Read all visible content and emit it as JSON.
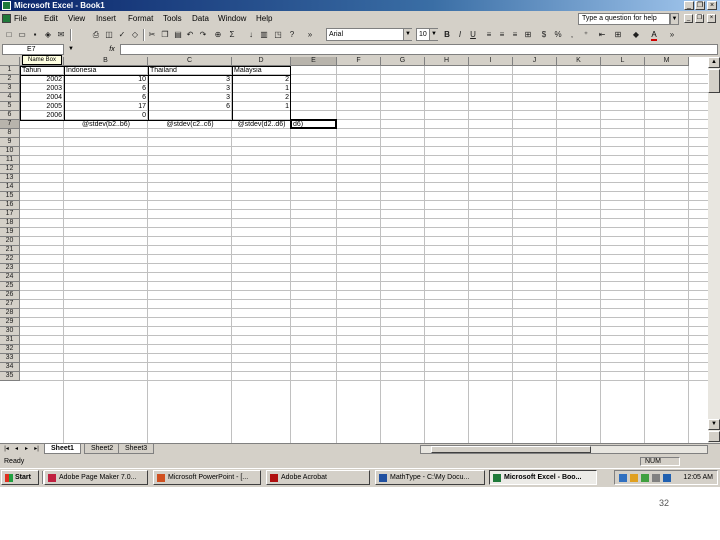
{
  "window": {
    "title": "Microsoft Excel - Book1"
  },
  "menu": [
    "File",
    "Edit",
    "View",
    "Insert",
    "Format",
    "Tools",
    "Data",
    "Window",
    "Help"
  ],
  "help_box": {
    "placeholder": "Type a question for help"
  },
  "toolbar": {
    "font_name": "Arial",
    "font_size": "10"
  },
  "name_box": {
    "value": "E7",
    "tooltip": "Name Box"
  },
  "columns": [
    "A",
    "B",
    "C",
    "D",
    "E",
    "F",
    "G",
    "H",
    "I",
    "J",
    "K",
    "L",
    "M"
  ],
  "active_column": "E",
  "active_row": "7",
  "rows": [
    "1",
    "2",
    "3",
    "4",
    "5",
    "6",
    "7",
    "8",
    "9",
    "10",
    "11",
    "12",
    "13",
    "14",
    "15",
    "16",
    "17",
    "18",
    "19",
    "20",
    "21",
    "22",
    "23",
    "24",
    "25",
    "26",
    "27",
    "28",
    "29",
    "30",
    "31",
    "32",
    "33",
    "34",
    "35"
  ],
  "table": {
    "headers": [
      "Tahun",
      "Indonesia",
      "Thailand",
      "Malaysia"
    ],
    "data": [
      [
        "2002",
        "10",
        "3",
        "2"
      ],
      [
        "2003",
        "6",
        "3",
        "1"
      ],
      [
        "2004",
        "6",
        "3",
        "2"
      ],
      [
        "2005",
        "17",
        "6",
        "1"
      ],
      [
        "2006",
        "0",
        "",
        ""
      ]
    ],
    "row7": [
      "@stdev(b2..b6)",
      "@stdev(c2..c6)",
      "@stdev(d2..d6)",
      "d6)"
    ]
  },
  "sheet_tabs": [
    "Sheet1",
    "Sheet2",
    "Sheet3"
  ],
  "active_sheet": "Sheet1",
  "status": {
    "left": "Ready",
    "indicator": "NUM"
  },
  "taskbar": {
    "start": "Start",
    "tasks": [
      "Adobe Page Maker 7.0...",
      "Microsoft PowerPoint - [...",
      "Adobe Acrobat",
      "MathType - C:\\My Docu...",
      "Microsoft Excel - Boo..."
    ],
    "active_task": "Microsoft Excel - Boo...",
    "clock": "12:05 AM"
  },
  "slide_number": "32",
  "colors": {
    "title_bar": "#0a246a",
    "chrome": "#d4d0c8",
    "grid_line": "#c0c0c0"
  }
}
